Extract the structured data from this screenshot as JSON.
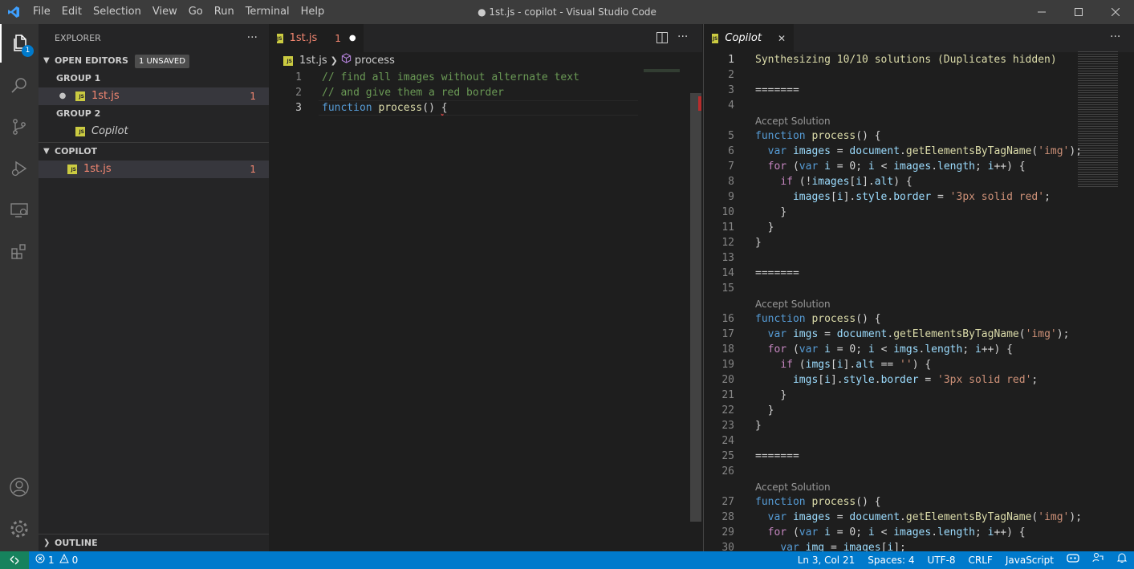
{
  "menu": [
    "File",
    "Edit",
    "Selection",
    "View",
    "Go",
    "Run",
    "Terminal",
    "Help"
  ],
  "window_title": "● 1st.js - copilot - Visual Studio Code",
  "activity": {
    "explorer_badge": "1"
  },
  "sidebar": {
    "title": "EXPLORER",
    "open_editors_label": "OPEN EDITORS",
    "unsaved_badge": "1 UNSAVED",
    "group1_label": "GROUP 1",
    "group1_file": "1st.js",
    "group1_count": "1",
    "group2_label": "GROUP 2",
    "group2_file": "Copilot",
    "folder_label": "COPILOT",
    "folder_file": "1st.js",
    "folder_count": "1",
    "outline_label": "OUTLINE"
  },
  "editor1": {
    "tab_label": "1st.js",
    "tab_count": "1",
    "breadcrumb_file": "1st.js",
    "breadcrumb_symbol": "process",
    "lines": [
      {
        "num": "1",
        "text": "// find all images without alternate text"
      },
      {
        "num": "2",
        "text": "// and give them a red border"
      },
      {
        "num": "3",
        "text": "function process() {"
      }
    ]
  },
  "editor2": {
    "tab_label": "Copilot",
    "header_text": "Synthesizing 10/10 solutions (Duplicates hidden)",
    "separator": "=======",
    "accept_label": "Accept Solution",
    "numbers": [
      "1",
      "2",
      "3",
      "4",
      "5",
      "6",
      "7",
      "8",
      "9",
      "10",
      "11",
      "12",
      "13",
      "14",
      "15",
      "16",
      "17",
      "18",
      "19",
      "20",
      "21",
      "22",
      "23",
      "24",
      "25",
      "26",
      "27",
      "28",
      "29",
      "30"
    ],
    "sol1": [
      "function process() {",
      "  var images = document.getElementsByTagName('img');",
      "  for (var i = 0; i < images.length; i++) {",
      "    if (!images[i].alt) {",
      "      images[i].style.border = '3px solid red';",
      "    }",
      "  }",
      "}"
    ],
    "sol2": [
      "function process() {",
      "  var imgs = document.getElementsByTagName('img');",
      "  for (var i = 0; i < imgs.length; i++) {",
      "    if (imgs[i].alt == '') {",
      "      imgs[i].style.border = '3px solid red';",
      "    }",
      "  }",
      "}"
    ],
    "sol3": [
      "function process() {",
      "  var images = document.getElementsByTagName('img');",
      "  for (var i = 0; i < images.length; i++) {",
      "    var img = images[i];"
    ]
  },
  "status": {
    "errors": "1",
    "warnings": "0",
    "position": "Ln 3, Col 21",
    "spaces": "Spaces: 4",
    "encoding": "UTF-8",
    "eol": "CRLF",
    "language": "JavaScript"
  }
}
